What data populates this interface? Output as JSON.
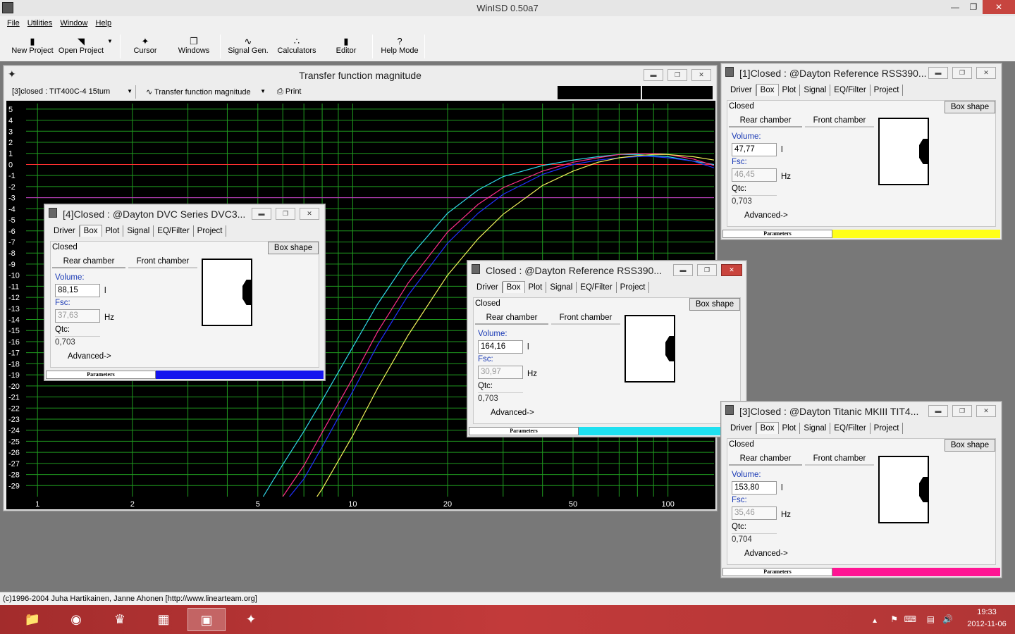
{
  "app": {
    "title": "WinISD 0.50a7",
    "menu": [
      "File",
      "Utilities",
      "Window",
      "Help"
    ],
    "toolbar": [
      {
        "label": "New Project",
        "icon": "new-project-icon"
      },
      {
        "label": "Open Project",
        "icon": "open-project-icon"
      },
      {
        "label": "Cursor",
        "icon": "cursor-icon"
      },
      {
        "label": "Windows",
        "icon": "windows-icon"
      },
      {
        "label": "Signal Gen.",
        "icon": "signal-gen-icon"
      },
      {
        "label": "Calculators",
        "icon": "calculators-icon"
      },
      {
        "label": "Editor",
        "icon": "editor-icon"
      },
      {
        "label": "Help Mode",
        "icon": "help-mode-icon"
      }
    ],
    "status": "(c)1996-2004 Juha Hartikainen, Janne Ahonen [http://www.linearteam.org]"
  },
  "plot_window": {
    "title": "Transfer function magnitude",
    "project_select": "[3]closed : TIT400C-4 15tum",
    "plot_select": "Transfer function magnitude",
    "print_label": "Print"
  },
  "chart_data": {
    "type": "line",
    "title": "Transfer function magnitude",
    "x_scale": "log",
    "xlim": [
      0.92,
      140
    ],
    "ylim": [
      -30,
      5.5
    ],
    "x_tick_labels": [
      "1",
      "2",
      "5",
      "10",
      "20",
      "50",
      "100"
    ],
    "x_ticks": [
      1,
      2,
      5,
      10,
      20,
      50,
      100
    ],
    "y_ticks": [
      5,
      4,
      3,
      2,
      1,
      0,
      -1,
      -2,
      -3,
      -4,
      -5,
      -6,
      -7,
      -8,
      -9,
      -10,
      -11,
      -12,
      -13,
      -14,
      -15,
      -16,
      -17,
      -18,
      -19,
      -20,
      -21,
      -22,
      -23,
      -24,
      -25,
      -26,
      -27,
      -28,
      -29
    ],
    "grid": true,
    "reference_lines": [
      {
        "y": 0,
        "color": "#ff3030"
      },
      {
        "y": -3,
        "color": "#cc33cc"
      }
    ],
    "series": [
      {
        "color": "#30d8e8",
        "x": [
          5.2,
          6,
          7,
          8,
          10,
          12,
          15,
          20,
          25,
          30,
          40,
          50,
          60,
          70,
          80,
          100,
          120,
          140
        ],
        "y": [
          -30,
          -27.1,
          -24.1,
          -21.3,
          -16.5,
          -12.6,
          -8.5,
          -4.4,
          -2.3,
          -1.1,
          -0.1,
          0.4,
          0.7,
          0.9,
          0.9,
          0.7,
          0.3,
          0
        ]
      },
      {
        "color": "#ff2d8a",
        "x": [
          6,
          7,
          8,
          10,
          12,
          15,
          20,
          25,
          30,
          40,
          50,
          60,
          70,
          80,
          90,
          100,
          120,
          140
        ],
        "y": [
          -30,
          -27.2,
          -24.2,
          -19.3,
          -15.1,
          -10.7,
          -6.1,
          -3.6,
          -2.1,
          -0.6,
          0.2,
          0.6,
          0.9,
          1.0,
          1.0,
          0.9,
          0.5,
          -0.1
        ]
      },
      {
        "color": "#2030ff",
        "x": [
          6.3,
          7,
          8,
          10,
          12,
          15,
          20,
          25,
          30,
          40,
          50,
          60,
          70,
          80,
          90,
          100,
          120,
          140
        ],
        "y": [
          -30,
          -28.4,
          -25.5,
          -20.5,
          -16.3,
          -11.8,
          -7.1,
          -4.4,
          -2.7,
          -0.9,
          0,
          0.4,
          0.6,
          0.7,
          0.7,
          0.6,
          0.3,
          -0.3
        ]
      },
      {
        "color": "#f2f25a",
        "x": [
          7.7,
          8,
          10,
          12,
          15,
          20,
          25,
          30,
          40,
          50,
          60,
          70,
          80,
          90,
          100,
          120,
          140
        ],
        "y": [
          -30,
          -29.3,
          -24.5,
          -20.2,
          -15.4,
          -10,
          -6.7,
          -4.5,
          -1.9,
          -0.6,
          0.2,
          0.6,
          0.8,
          0.9,
          0.9,
          0.7,
          0.4
        ]
      }
    ]
  },
  "box_labels": {
    "tabs": [
      "Driver",
      "Box",
      "Plot",
      "Signal",
      "EQ/Filter",
      "Project"
    ],
    "closed": "Closed",
    "box_shape": "Box shape",
    "rear": "Rear chamber",
    "front": "Front chamber",
    "volume": "Volume:",
    "fsc": "Fsc:",
    "qtc": "Qtc:",
    "vol_unit": "l",
    "fsc_unit": "Hz",
    "advanced": "Advanced->",
    "parameters": "Parameters"
  },
  "project_windows": [
    {
      "title": "[4]Closed : @Dayton DVC Series DVC3...",
      "volume": "88,15",
      "fsc": "37,63",
      "qtc": "0,703",
      "color": "#1414ee"
    },
    {
      "title": "[1]Closed : @Dayton Reference RSS390...",
      "volume": "47,77",
      "fsc": "46,45",
      "qtc": "0,703",
      "color": "#ffff1a"
    },
    {
      "title": "[3]Closed : @Dayton Titanic MKIII TIT4...",
      "volume": "153,80",
      "fsc": "35,46",
      "qtc": "0,704",
      "color": "#ff1493"
    },
    {
      "title": "Closed : @Dayton Reference RSS390...",
      "volume": "164,16",
      "fsc": "30,97",
      "qtc": "0,703",
      "color": "#1ee0f0"
    }
  ],
  "tray": {
    "time": "19:33",
    "date": "2012-11-06"
  }
}
